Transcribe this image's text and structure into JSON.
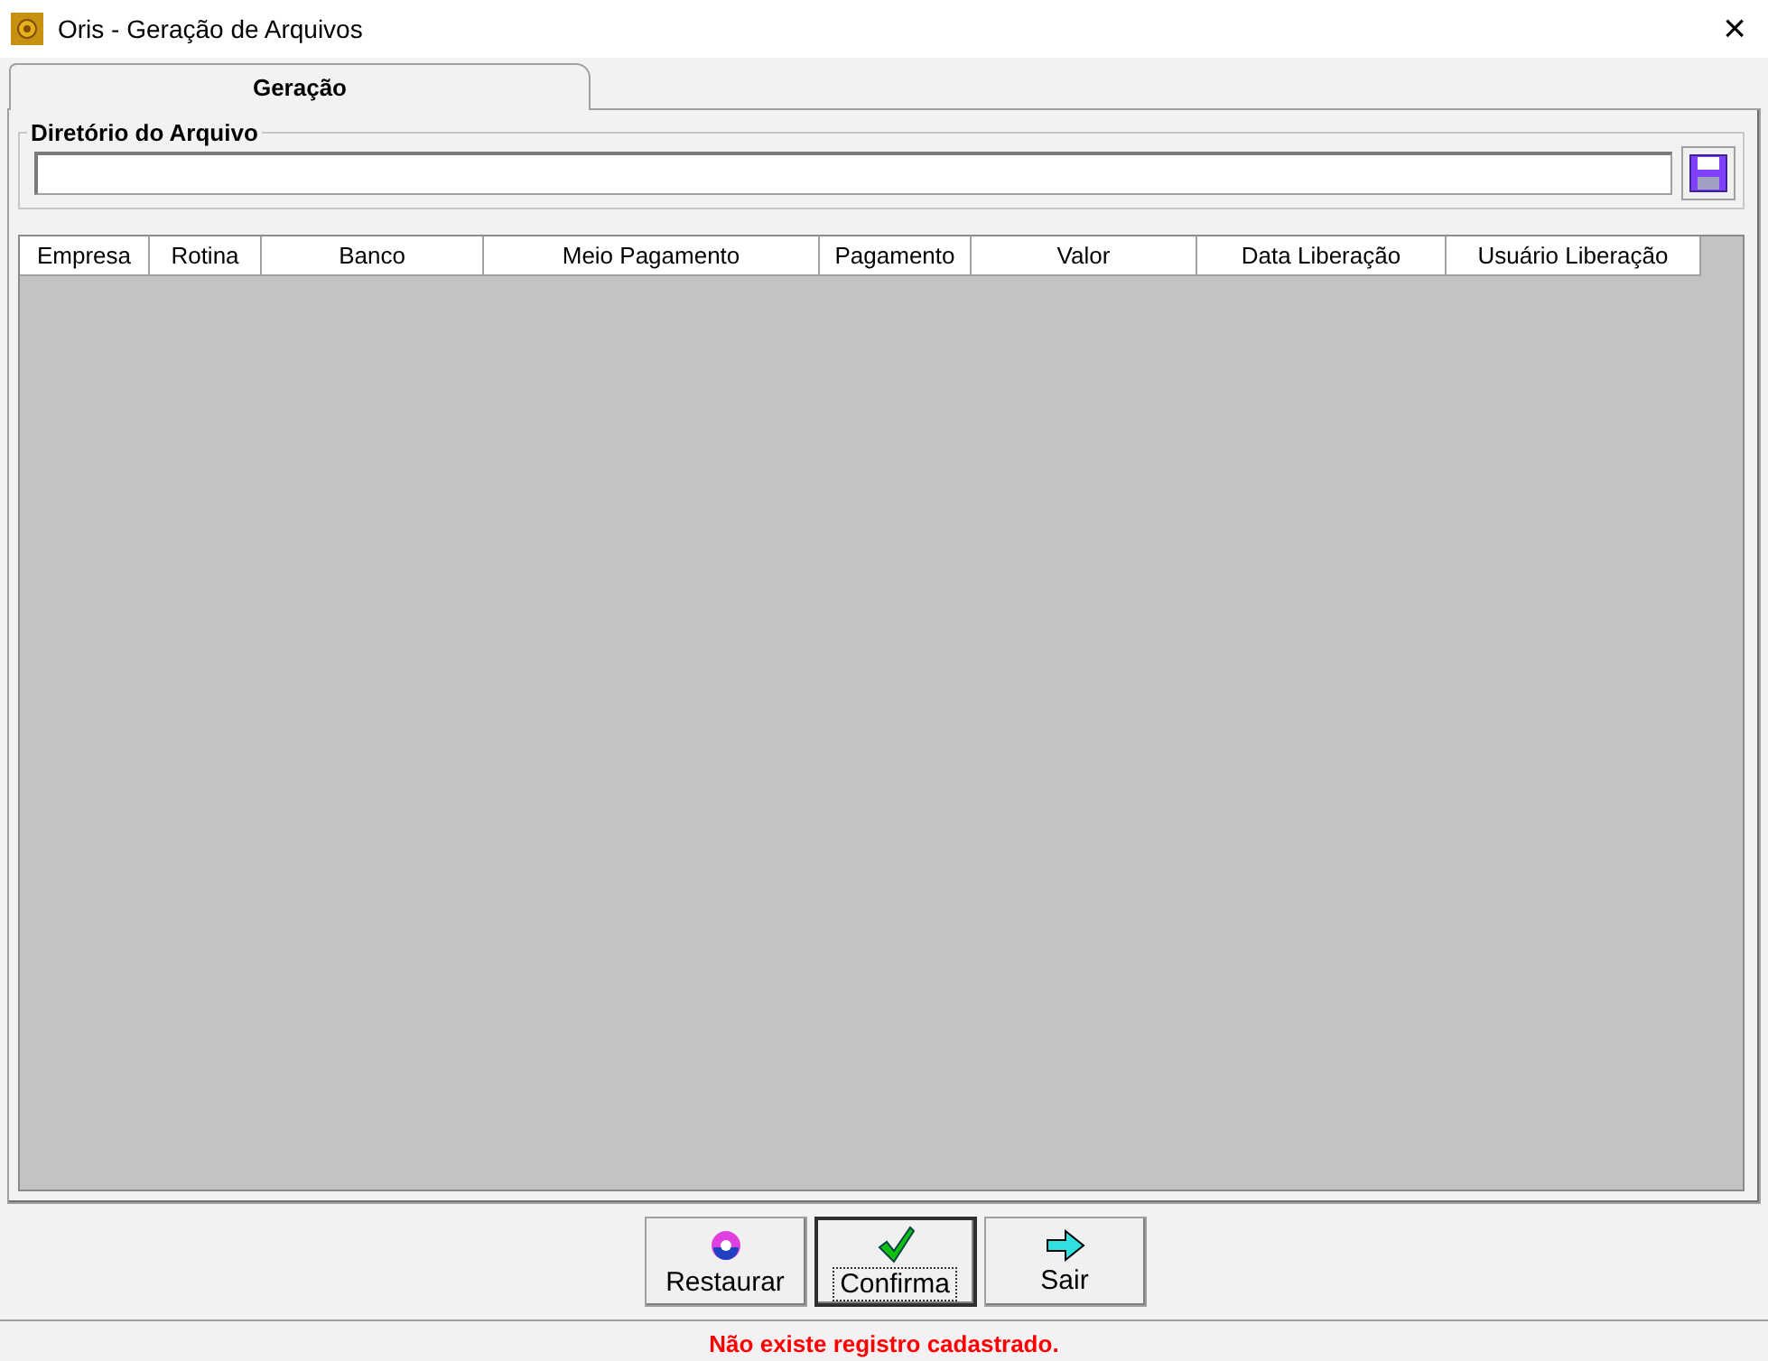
{
  "window": {
    "title": "Oris - Geração de Arquivos",
    "close": "×"
  },
  "tabs": [
    {
      "label": "Geração",
      "selected": true
    }
  ],
  "directory": {
    "legend": "Diretório do Arquivo"
  },
  "table": {
    "columns": [
      "Empresa",
      "Rotina",
      "Banco",
      "Meio Pagamento",
      "Pagamento",
      "Valor",
      "Data Liberação",
      "Usuário Liberação"
    ]
  },
  "buttons": [
    {
      "label": "Restaurar",
      "kind": "restore",
      "focused": false
    },
    {
      "label": "Confirma",
      "kind": "confirm",
      "focused": true
    },
    {
      "label": "Sair",
      "kind": "exit",
      "focused": false
    }
  ],
  "status_bar": "Não existe registro cadastrado."
}
